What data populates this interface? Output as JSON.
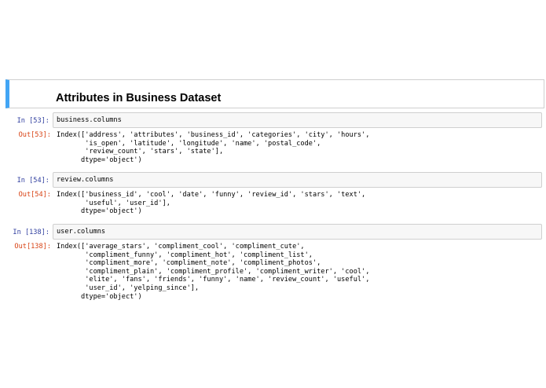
{
  "heading": "Attributes in Business Dataset",
  "cells": [
    {
      "in_prompt": "In [53]:",
      "code": "business.columns",
      "out_prompt": "Out[53]:",
      "output": "Index(['address', 'attributes', 'business_id', 'categories', 'city', 'hours',\n       'is_open', 'latitude', 'longitude', 'name', 'postal_code',\n       'review_count', 'stars', 'state'],\n      dtype='object')"
    },
    {
      "in_prompt": "In [54]:",
      "code": "review.columns",
      "out_prompt": "Out[54]:",
      "output": "Index(['business_id', 'cool', 'date', 'funny', 'review_id', 'stars', 'text',\n       'useful', 'user_id'],\n      dtype='object')"
    },
    {
      "in_prompt": "In [138]:",
      "code": "user.columns",
      "out_prompt": "Out[138]:",
      "output": "Index(['average_stars', 'compliment_cool', 'compliment_cute',\n       'compliment_funny', 'compliment_hot', 'compliment_list',\n       'compliment_more', 'compliment_note', 'compliment_photos',\n       'compliment_plain', 'compliment_profile', 'compliment_writer', 'cool',\n       'elite', 'fans', 'friends', 'funny', 'name', 'review_count', 'useful',\n       'user_id', 'yelping_since'],\n      dtype='object')"
    }
  ]
}
